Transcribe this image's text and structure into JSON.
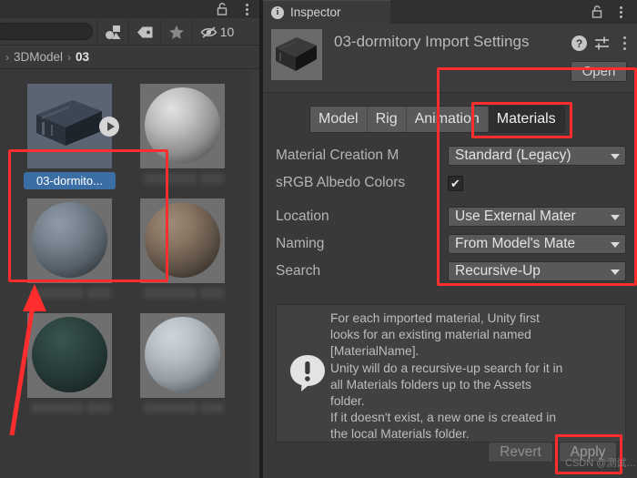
{
  "project_panel": {
    "lock_icon": "unlock-icon",
    "menu_icon": "kebab-menu-icon",
    "search": {
      "value": "",
      "placeholder": ""
    },
    "filters": [
      {
        "name": "type-filter",
        "icon": "shapes-filter-icon"
      },
      {
        "name": "label-filter",
        "icon": "tag-icon"
      },
      {
        "name": "favorite-filter",
        "icon": "star-icon"
      },
      {
        "name": "hidden-filter",
        "icon": "eye-crossed-icon",
        "count": "10"
      }
    ],
    "breadcrumb": {
      "chevron": "›",
      "segments": [
        "3DModel",
        "03"
      ]
    },
    "assets": [
      {
        "name": "03-dormito...",
        "kind": "model",
        "selected": true
      },
      {
        "name": "",
        "kind": "material-light",
        "selected": false
      },
      {
        "name": "",
        "kind": "material-blue",
        "selected": false
      },
      {
        "name": "",
        "kind": "material-brown",
        "selected": false
      },
      {
        "name": "",
        "kind": "material-green",
        "selected": false
      },
      {
        "name": "",
        "kind": "material-grey",
        "selected": false
      }
    ]
  },
  "inspector": {
    "tab_label": "Inspector",
    "tab_icon": "info-icon",
    "lock_icon": "unlock-icon",
    "menu_icon": "kebab-menu-icon",
    "title": "03-dormitory Import Settings",
    "help_icon": "help-icon",
    "preset_icon": "preset-sliders-icon",
    "header_menu_icon": "kebab-menu-icon",
    "open_button": "Open",
    "tabs": [
      {
        "label": "Model",
        "active": false
      },
      {
        "label": "Rig",
        "active": false
      },
      {
        "label": "Animation",
        "active": false
      },
      {
        "label": "Materials",
        "active": true
      }
    ],
    "properties": {
      "material_creation_mode": {
        "label": "Material Creation M",
        "value": "Standard (Legacy)"
      },
      "srgb_albedo_colors": {
        "label": "sRGB Albedo Colors",
        "checked": true,
        "check_glyph": "✔"
      },
      "location": {
        "label": "Location",
        "value": "Use External Mater"
      },
      "naming": {
        "label": "Naming",
        "value": "From Model's Mate"
      },
      "search": {
        "label": "Search",
        "value": "Recursive-Up"
      }
    },
    "help_box": {
      "icon": "warning-speech-icon",
      "text": "For each imported material, Unity first\nlooks for an existing material named\n[MaterialName].\nUnity will do a recursive-up search for it in\nall Materials folders up to the Assets\nfolder.\nIf it doesn't exist, a new one is created in\nthe local Materials folder."
    },
    "footer": {
      "revert": "Revert",
      "apply": "Apply"
    }
  },
  "watermark": "CSDN @测试…",
  "colors": {
    "highlight": "#ff2d2d",
    "selection_blue": "#3a6ea5",
    "panel_bg": "#393939",
    "header_bg": "#3c3c3c"
  }
}
